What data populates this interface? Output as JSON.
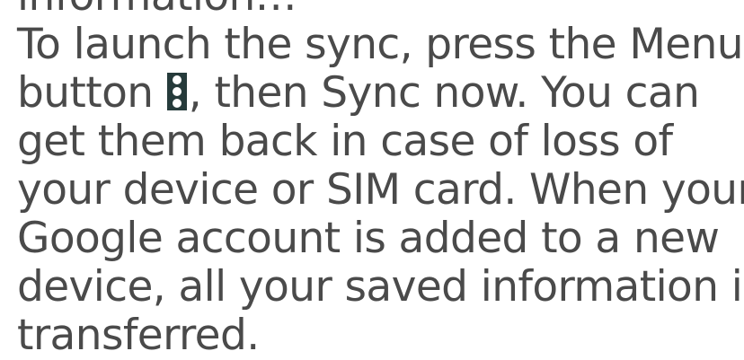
{
  "paragraph": {
    "line0": "information…",
    "line1": "To launch the sync, press the Menu",
    "line2_before_icon": "button ",
    "line2_after_icon": ", then Sync now. You can",
    "line3": "get them back in case of loss of",
    "line4": "your device or SIM card. When your",
    "line5": "Google account is added to a new",
    "line6": "device, all your saved information is",
    "line7": "transferred."
  },
  "icons": {
    "menu": "vertical-ellipsis-menu-icon"
  },
  "colors": {
    "text": "#4a4a4a",
    "icon_background": "#263b3b",
    "icon_dots": "#ffffff"
  }
}
